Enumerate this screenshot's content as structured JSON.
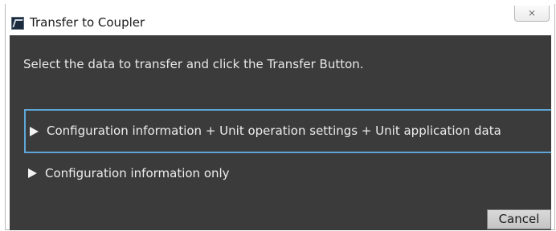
{
  "window": {
    "title": "Transfer to Coupler",
    "app_icon": "app-icon",
    "close_glyph": "⨯"
  },
  "content": {
    "instruction": "Select the data to transfer and click the Transfer Button.",
    "options": [
      {
        "label": "Configuration information + Unit operation settings + Unit application data",
        "selected": true,
        "icon": "triangle-right-icon"
      },
      {
        "label": "Configuration information only",
        "selected": false,
        "icon": "triangle-right-icon"
      }
    ],
    "cancel_label": "Cancel"
  },
  "colors": {
    "dialog_background": "#3b3b3b",
    "selection_border": "#5fa6d8",
    "text": "#e8e8e8"
  }
}
